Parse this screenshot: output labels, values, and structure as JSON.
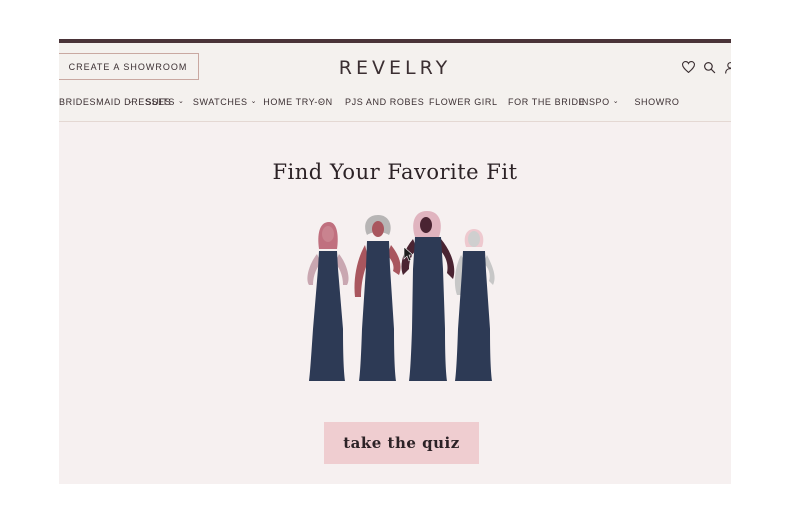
{
  "header": {
    "showroom_button": "CREATE A SHOWROOM",
    "logo": "REVELRY",
    "icons": [
      "heart-icon",
      "search-icon",
      "user-icon"
    ]
  },
  "nav": [
    {
      "label": "BRIDESMAID DRESSES",
      "dropdown": true
    },
    {
      "label": "SUITS",
      "dropdown": true
    },
    {
      "label": "SWATCHES",
      "dropdown": true
    },
    {
      "label": "HOME TRY-ON",
      "dropdown": true
    },
    {
      "label": "PJS AND ROBES",
      "dropdown": false
    },
    {
      "label": "FLOWER GIRL",
      "dropdown": false
    },
    {
      "label": "FOR THE BRIDE",
      "dropdown": false
    },
    {
      "label": "INSPO",
      "dropdown": true
    },
    {
      "label": "SHOWRO",
      "dropdown": false
    }
  ],
  "hero": {
    "title": "Find Your Favorite Fit",
    "quiz_button": "take the quiz"
  },
  "colors": {
    "page_bg": "#f6f0f0",
    "header_bg": "#f4f1ee",
    "text": "#3b2f32",
    "quiz_button_bg": "#efcdd0",
    "dress": "#2d3a55"
  }
}
